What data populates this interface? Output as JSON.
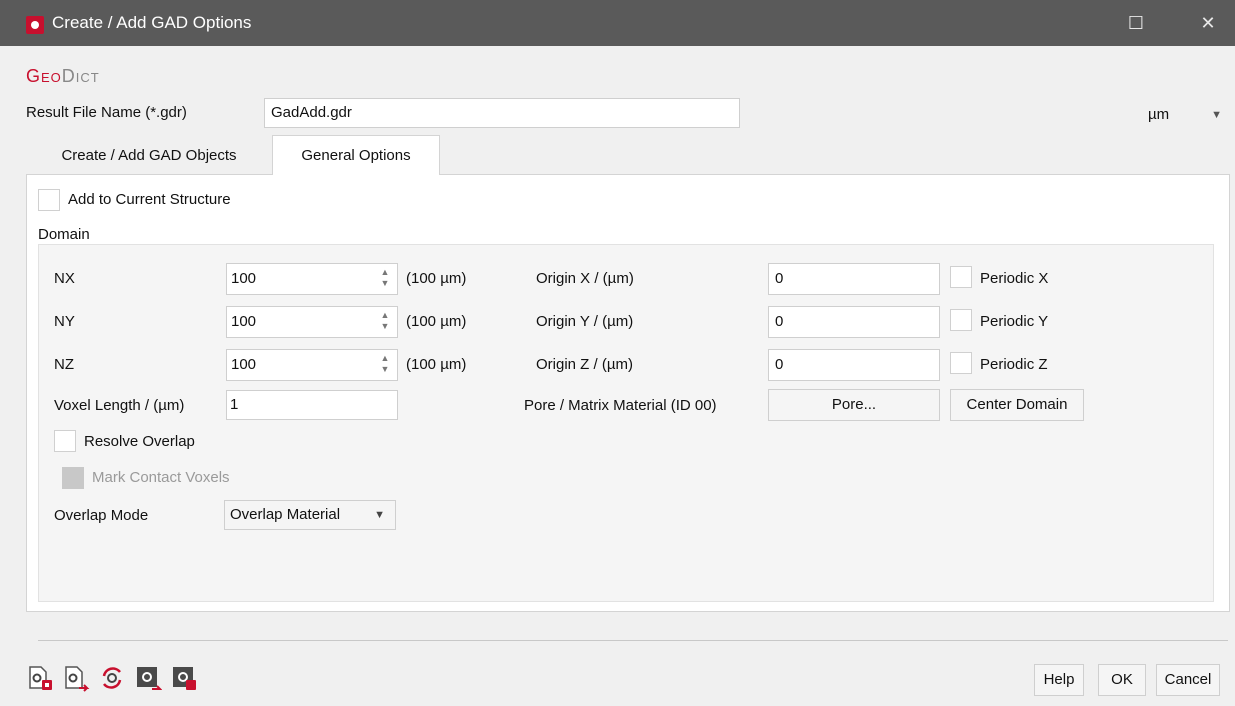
{
  "window": {
    "title": "Create / Add GAD Options",
    "maximize_glyph": "☐",
    "close_glyph": "✕"
  },
  "brand": {
    "geo": "Geo",
    "dict": "Dict"
  },
  "result_file": {
    "label": "Result File Name (*.gdr)",
    "value": "GadAdd.gdr"
  },
  "unit": {
    "selected": "µm"
  },
  "tabs": [
    {
      "label": "Create / Add GAD Objects",
      "active": false
    },
    {
      "label": "General Options",
      "active": true
    }
  ],
  "general": {
    "add_to_current_label": "Add to Current Structure",
    "domain_label": "Domain",
    "dimensions": [
      {
        "label": "NX",
        "value": "100",
        "size": "(100 µm)",
        "origin_label": "Origin X / (µm)",
        "origin_value": "0",
        "periodic_label": "Periodic X"
      },
      {
        "label": "NY",
        "value": "100",
        "size": "(100 µm)",
        "origin_label": "Origin Y / (µm)",
        "origin_value": "0",
        "periodic_label": "Periodic Y"
      },
      {
        "label": "NZ",
        "value": "100",
        "size": "(100 µm)",
        "origin_label": "Origin Z / (µm)",
        "origin_value": "0",
        "periodic_label": "Periodic Z"
      }
    ],
    "voxel_length_label": "Voxel Length / (µm)",
    "voxel_length_value": "1",
    "pore_matrix_label": "Pore / Matrix Material (ID 00)",
    "pore_button": "Pore...",
    "center_domain_button": "Center Domain",
    "resolve_overlap_label": "Resolve Overlap",
    "mark_contact_label": "Mark Contact Voxels",
    "overlap_mode_label": "Overlap Mode",
    "overlap_mode_value": "Overlap Material"
  },
  "footer": {
    "tool_icons": [
      "load-settings-icon",
      "save-settings-icon",
      "reset-settings-icon",
      "import-macro-icon",
      "export-macro-icon"
    ],
    "help_button": "Help",
    "ok_button": "OK",
    "cancel_button": "Cancel"
  },
  "colors": {
    "titlebar": "#5a5a5a",
    "brand_red": "#c8102e"
  }
}
